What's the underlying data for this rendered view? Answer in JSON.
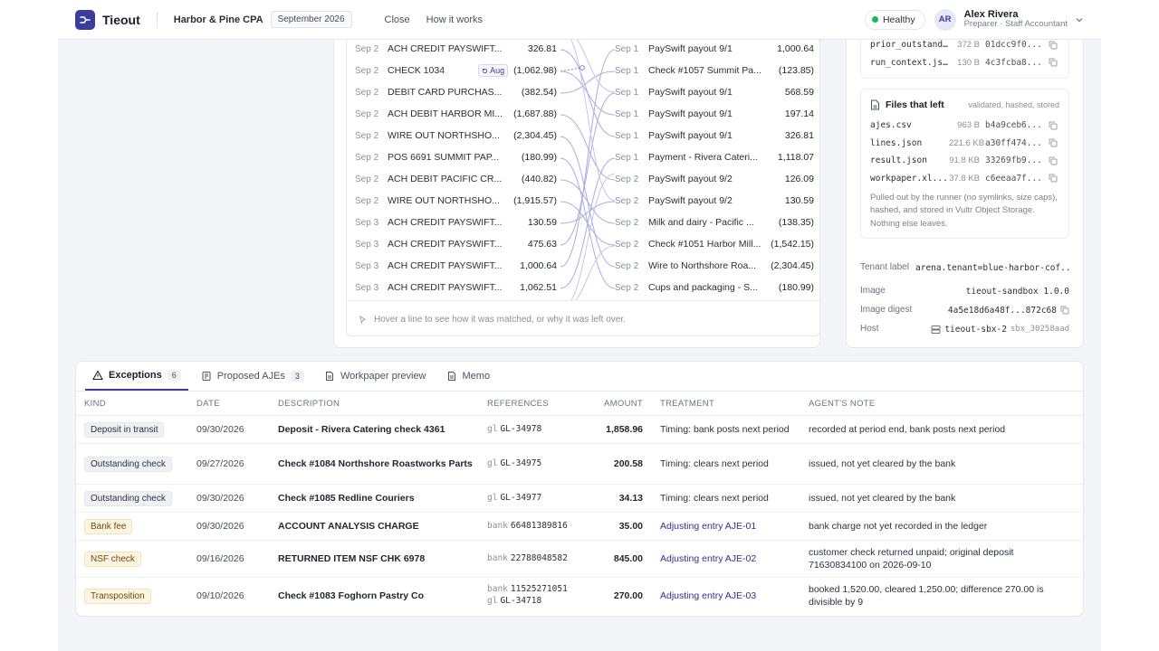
{
  "header": {
    "brand": "Tieout",
    "firm": "Harbor & Pine CPA",
    "period": "September 2026",
    "nav": [
      "Close",
      "How it works"
    ],
    "health": "Healthy",
    "user": {
      "initials": "AR",
      "name": "Alex Rivera",
      "role": "Preparer · Staff Accountant"
    }
  },
  "colors": {
    "accent": "#3b3c9b",
    "healthy": "#22b45a",
    "warn_badge": "#fdf5e2"
  },
  "match": {
    "bank": [
      {
        "date": "Sep 2",
        "desc": "ACH CREDIT PAYSWIFT...",
        "amount": "326.81"
      },
      {
        "date": "Sep 2",
        "desc": "CHECK 1034",
        "amount": "(1,062.98)",
        "tag": "Aug"
      },
      {
        "date": "Sep 2",
        "desc": "DEBIT CARD PURCHAS...",
        "amount": "(382.54)"
      },
      {
        "date": "Sep 2",
        "desc": "ACH DEBIT HARBOR MI...",
        "amount": "(1,687.88)"
      },
      {
        "date": "Sep 2",
        "desc": "WIRE OUT NORTHSHO...",
        "amount": "(2,304.45)"
      },
      {
        "date": "Sep 2",
        "desc": "POS 6691 SUMMIT PAP...",
        "amount": "(180.99)"
      },
      {
        "date": "Sep 2",
        "desc": "ACH DEBIT PACIFIC CR...",
        "amount": "(440.82)"
      },
      {
        "date": "Sep 2",
        "desc": "WIRE OUT NORTHSHO...",
        "amount": "(1,915.57)"
      },
      {
        "date": "Sep 3",
        "desc": "ACH CREDIT PAYSWIFT...",
        "amount": "130.59"
      },
      {
        "date": "Sep 3",
        "desc": "ACH CREDIT PAYSWIFT...",
        "amount": "475.63"
      },
      {
        "date": "Sep 3",
        "desc": "ACH CREDIT PAYSWIFT...",
        "amount": "1,000.64"
      },
      {
        "date": "Sep 3",
        "desc": "ACH CREDIT PAYSWIFT...",
        "amount": "1,062.51"
      }
    ],
    "ledger": [
      {
        "date": "Sep 1",
        "desc": "PaySwift payout 9/1",
        "amount": "1,000.64"
      },
      {
        "date": "Sep 1",
        "desc": "Check #1057 Summit Pa...",
        "amount": "(123.85)"
      },
      {
        "date": "Sep 1",
        "desc": "PaySwift payout 9/1",
        "amount": "568.59"
      },
      {
        "date": "Sep 1",
        "desc": "PaySwift payout 9/1",
        "amount": "197.14"
      },
      {
        "date": "Sep 1",
        "desc": "PaySwift payout 9/1",
        "amount": "326.81"
      },
      {
        "date": "Sep 1",
        "desc": "Payment - Rivera Cateri...",
        "amount": "1,118.07"
      },
      {
        "date": "Sep 2",
        "desc": "PaySwift payout 9/2",
        "amount": "126.09"
      },
      {
        "date": "Sep 2",
        "desc": "PaySwift payout 9/2",
        "amount": "130.59"
      },
      {
        "date": "Sep 2",
        "desc": "Milk and dairy - Pacific ...",
        "amount": "(138.35)"
      },
      {
        "date": "Sep 2",
        "desc": "Check #1051 Harbor Mill...",
        "amount": "(1,542.15)"
      },
      {
        "date": "Sep 2",
        "desc": "Wire to Northshore Roa...",
        "amount": "(2,304.45)"
      },
      {
        "date": "Sep 2",
        "desc": "Cups and packaging - S...",
        "amount": "(180.99)"
      }
    ],
    "hint": "Hover a line to see how it was matched, or why it was left over."
  },
  "side": {
    "top_files": [
      {
        "name": "prior_outstand...",
        "size": "372 B",
        "hash": "01dcc9f0..."
      },
      {
        "name": "run_context.js...",
        "size": "130 B",
        "hash": "4c3fcba8..."
      }
    ],
    "files_left": {
      "title": "Files that left",
      "subtitle": "validated, hashed, stored",
      "items": [
        {
          "name": "ajes.csv",
          "size": "963 B",
          "hash": "b4a9ceb6..."
        },
        {
          "name": "lines.json",
          "size": "221.6 KB",
          "hash": "a30ff474..."
        },
        {
          "name": "result.json",
          "size": "91.8 KB",
          "hash": "33269fb9..."
        },
        {
          "name": "workpaper.xl...",
          "size": "37.8 KB",
          "hash": "c6eeaa7f..."
        }
      ],
      "note": "Pulled out by the runner (no symlinks, size caps), hashed, and stored in Vultr Object Storage. Nothing else leaves."
    },
    "meta": {
      "tenant_label_key": "Tenant label",
      "tenant_label": "arena.tenant=blue-harbor-cof...",
      "image_key": "Image",
      "image": "tieout-sandbox 1.0.0",
      "digest_key": "Image digest",
      "digest": "4a5e18d6a48f...872c68",
      "host_key": "Host",
      "host": "tieout-sbx-2",
      "host_id": "sbx_30258aad"
    }
  },
  "exceptions": {
    "tabs": [
      {
        "label": "Exceptions",
        "count": "6",
        "icon": "warning-icon"
      },
      {
        "label": "Proposed AJEs",
        "count": "3",
        "icon": "ledger-icon"
      },
      {
        "label": "Workpaper preview",
        "count": "",
        "icon": "document-icon"
      },
      {
        "label": "Memo",
        "count": "",
        "icon": "document-icon"
      }
    ],
    "columns": [
      "KIND",
      "DATE",
      "DESCRIPTION",
      "REFERENCES",
      "AMOUNT",
      "TREATMENT",
      "AGENT'S NOTE"
    ],
    "rows": [
      {
        "kind": "Deposit in transit",
        "kind_style": "neutral",
        "date": "09/30/2026",
        "desc": "Deposit - Rivera Catering check 4361",
        "refs": [
          {
            "k": "gl",
            "v": "GL-34978"
          }
        ],
        "amount": "1,858.96",
        "treatment": "Timing: bank posts next period",
        "adj": false,
        "note": "recorded at period end, bank posts next period"
      },
      {
        "kind": "Outstanding check",
        "kind_style": "neutral",
        "date": "09/27/2026",
        "desc": "Check #1084 Northshore Roastworks Parts",
        "refs": [
          {
            "k": "gl",
            "v": "GL-34975"
          }
        ],
        "amount": "200.58",
        "treatment": "Timing: clears next period",
        "adj": false,
        "note": "issued, not yet cleared by the bank"
      },
      {
        "kind": "Outstanding check",
        "kind_style": "neutral",
        "date": "09/30/2026",
        "desc": "Check #1085 Redline Couriers",
        "refs": [
          {
            "k": "gl",
            "v": "GL-34977"
          }
        ],
        "amount": "34.13",
        "treatment": "Timing: clears next period",
        "adj": false,
        "note": "issued, not yet cleared by the bank"
      },
      {
        "kind": "Bank fee",
        "kind_style": "warn",
        "date": "09/30/2026",
        "desc": "ACCOUNT ANALYSIS CHARGE",
        "refs": [
          {
            "k": "bank",
            "v": "66481389816"
          }
        ],
        "amount": "35.00",
        "treatment": "Adjusting entry AJE-01",
        "adj": true,
        "note": "bank charge not yet recorded in the ledger"
      },
      {
        "kind": "NSF check",
        "kind_style": "warn",
        "date": "09/16/2026",
        "desc": "RETURNED ITEM NSF CHK 6978",
        "refs": [
          {
            "k": "bank",
            "v": "22788048582"
          }
        ],
        "amount": "845.00",
        "treatment": "Adjusting entry AJE-02",
        "adj": true,
        "note": "customer check returned unpaid; original deposit 71630834100 on 2026-09-10"
      },
      {
        "kind": "Transposition",
        "kind_style": "warn",
        "date": "09/10/2026",
        "desc": "Check #1083 Foghorn Pastry Co",
        "refs": [
          {
            "k": "bank",
            "v": "11525271051"
          },
          {
            "k": "gl",
            "v": "GL-34718"
          }
        ],
        "amount": "270.00",
        "treatment": "Adjusting entry AJE-03",
        "adj": true,
        "note": "booked 1,520.00, cleared 1,250.00; difference 270.00 is divisible by 9"
      }
    ]
  }
}
